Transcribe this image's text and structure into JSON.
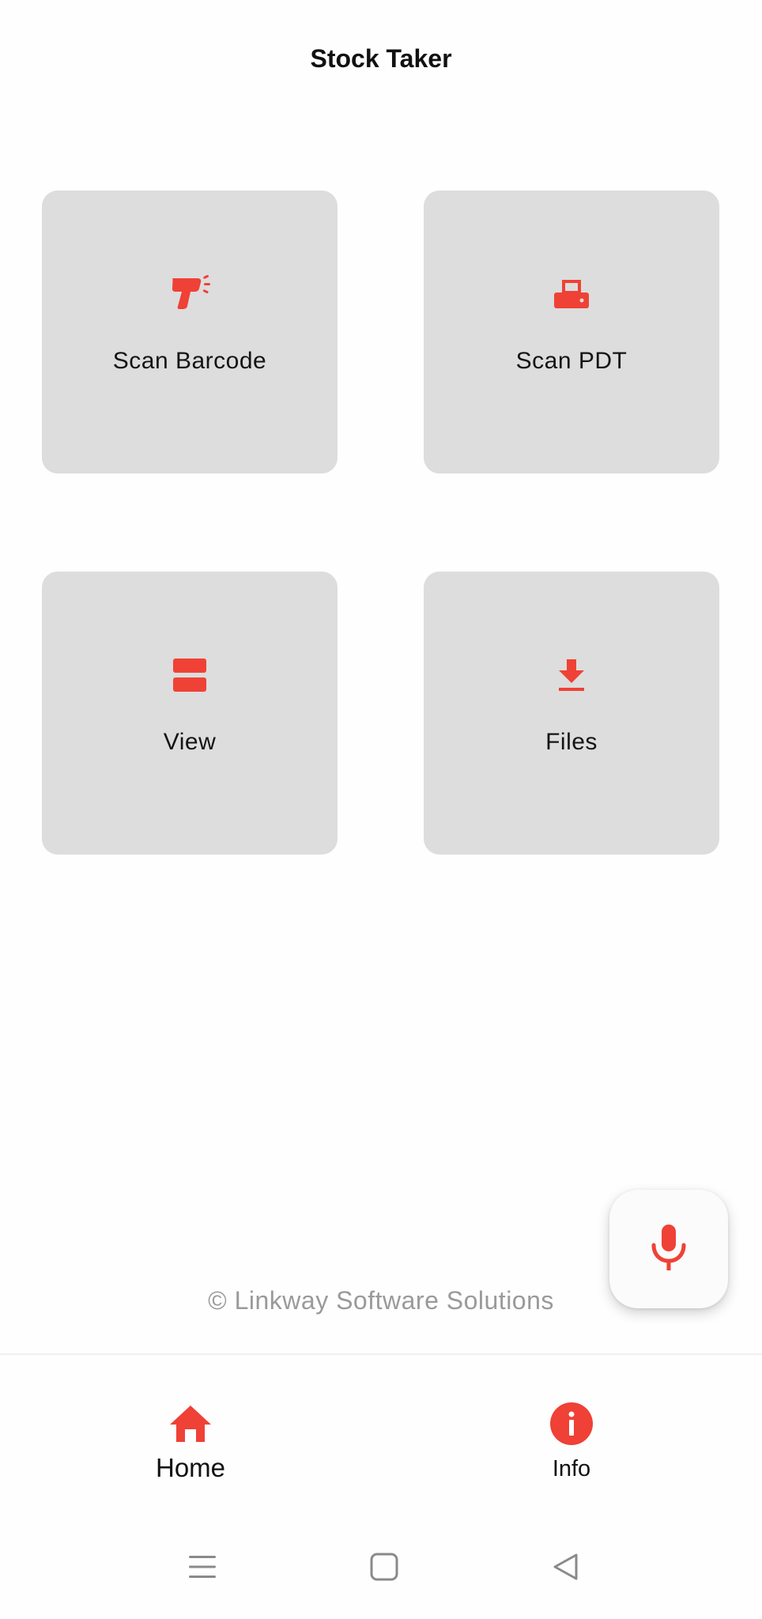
{
  "app": {
    "title": "Stock Taker"
  },
  "tiles": [
    {
      "label": "Scan Barcode",
      "icon": "barcode-scanner-icon"
    },
    {
      "label": "Scan PDT",
      "icon": "printer-icon"
    },
    {
      "label": "View",
      "icon": "view-agenda-icon"
    },
    {
      "label": "Files",
      "icon": "download-icon"
    }
  ],
  "fab": {
    "icon": "microphone-icon"
  },
  "footer": {
    "copyright": "© Linkway Software Solutions"
  },
  "bottom_nav": {
    "items": [
      {
        "label": "Home",
        "icon": "home-icon",
        "active": true
      },
      {
        "label": "Info",
        "icon": "info-icon",
        "active": false
      }
    ]
  },
  "system_nav": {
    "icons": [
      "menu-icon",
      "square-home-icon",
      "back-triangle-icon"
    ]
  },
  "colors": {
    "accent": "#ef4136",
    "tile_background": "#dddddd",
    "background": "#fefefe",
    "muted_text": "#9a9a9a",
    "system_icon": "#8a8a8a"
  }
}
